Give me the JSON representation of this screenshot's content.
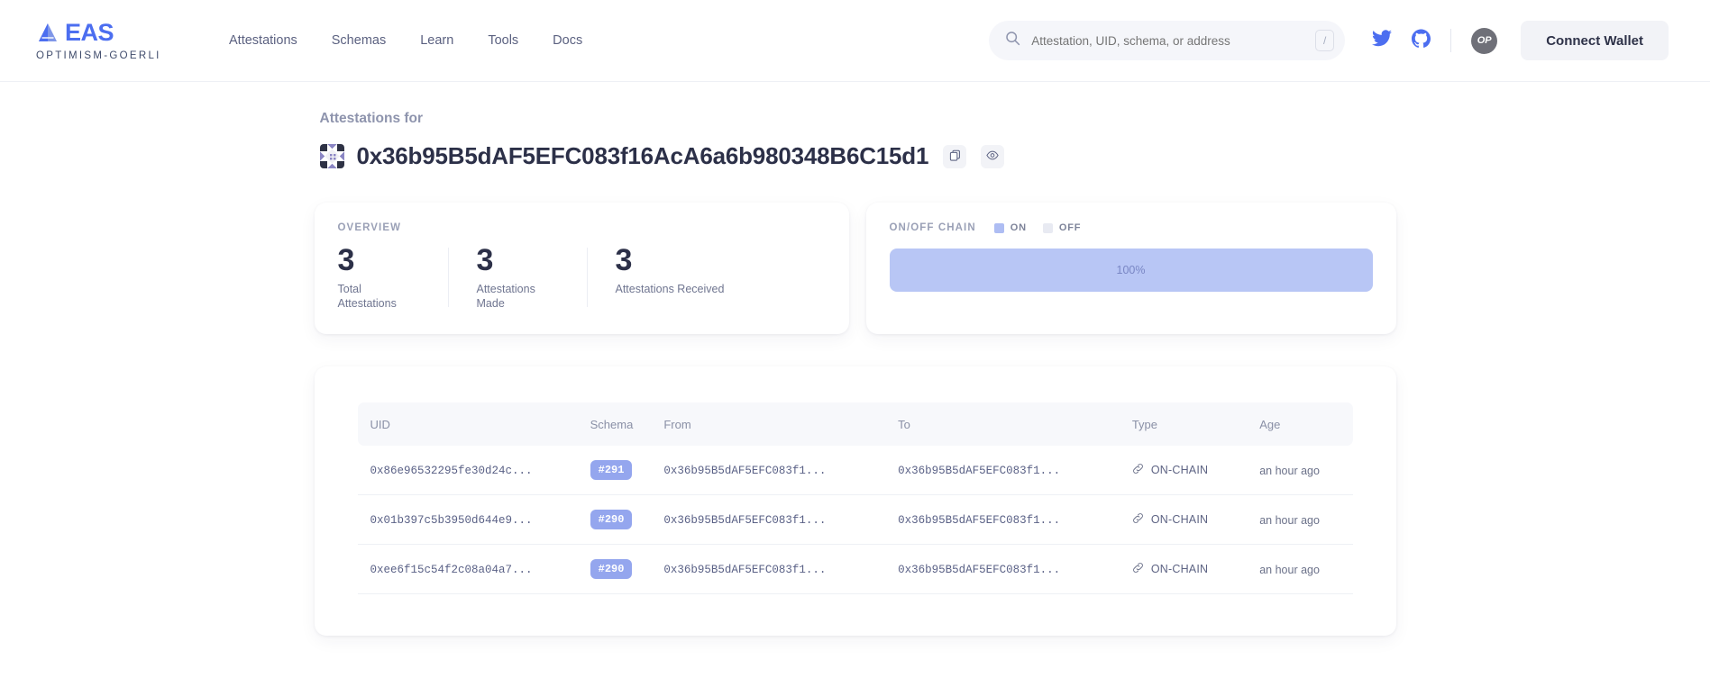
{
  "header": {
    "brand": {
      "name": "EAS",
      "network": "OPTIMISM-GOERLI",
      "logo_icon": "eas-triangle-logo"
    },
    "nav": [
      {
        "label": "Attestations"
      },
      {
        "label": "Schemas"
      },
      {
        "label": "Learn"
      },
      {
        "label": "Tools"
      },
      {
        "label": "Docs"
      }
    ],
    "search": {
      "placeholder": "Attestation, UID, schema, or address",
      "value": "",
      "shortcut": "/",
      "icon": "search-icon"
    },
    "twitter_icon": "twitter-icon",
    "github_icon": "github-icon",
    "chain_badge": "OP",
    "connect_label": "Connect Wallet"
  },
  "page": {
    "eyebrow": "Attestations for",
    "address": "0x36b95B5dAF5EFC083f16AcA6a6b980348B6C15d1",
    "copy_icon": "copy-icon",
    "view_icon": "eye-icon"
  },
  "overview": {
    "label": "OVERVIEW",
    "stats": [
      {
        "value": "3",
        "label": "Total Attestations"
      },
      {
        "value": "3",
        "label": "Attestations Made"
      },
      {
        "value": "3",
        "label": "Attestations Received"
      }
    ]
  },
  "chain": {
    "label": "ON/OFF CHAIN",
    "legend": [
      {
        "label": "ON",
        "color": "#aebdf3"
      },
      {
        "label": "OFF",
        "color": "#e8eaf2"
      }
    ],
    "on_percent_label": "100%",
    "on_percent": 100,
    "off_percent": 0
  },
  "table": {
    "columns": [
      "UID",
      "Schema",
      "From",
      "To",
      "Type",
      "Age"
    ],
    "rows": [
      {
        "uid": "0x86e96532295fe30d24c...",
        "schema": "#291",
        "from": "0x36b95B5dAF5EFC083f1...",
        "to": "0x36b95B5dAF5EFC083f1...",
        "type": "ON-CHAIN",
        "type_icon": "link-icon",
        "age": "an hour ago"
      },
      {
        "uid": "0x01b397c5b3950d644e9...",
        "schema": "#290",
        "from": "0x36b95B5dAF5EFC083f1...",
        "to": "0x36b95B5dAF5EFC083f1...",
        "type": "ON-CHAIN",
        "type_icon": "link-icon",
        "age": "an hour ago"
      },
      {
        "uid": "0xee6f15c54f2c08a04a7...",
        "schema": "#290",
        "from": "0x36b95B5dAF5EFC083f1...",
        "to": "0x36b95B5dAF5EFC083f1...",
        "type": "ON-CHAIN",
        "type_icon": "link-icon",
        "age": "an hour ago"
      }
    ]
  },
  "colors": {
    "accent": "#4c6ef0",
    "badge": "#94a6ee",
    "bar_fill": "#b8c6f5",
    "bar_track": "#eef0f6",
    "text_dark": "#2c3048",
    "text_muted": "#8a90a6"
  }
}
